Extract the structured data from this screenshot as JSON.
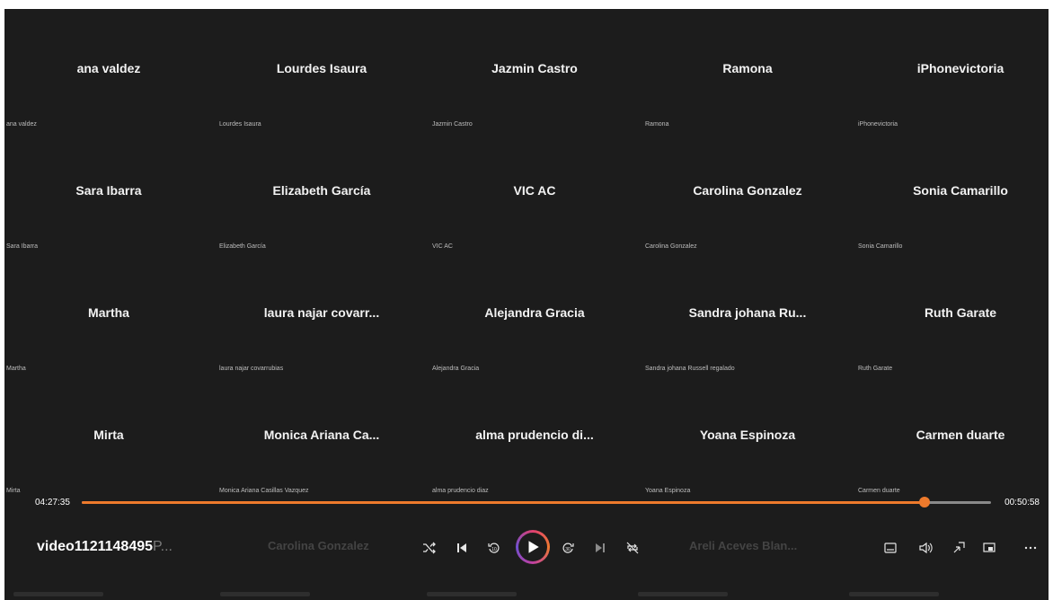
{
  "tiles": [
    {
      "big": "ana valdez",
      "small": "ana valdez"
    },
    {
      "big": "Lourdes Isaura",
      "small": "Lourdes Isaura"
    },
    {
      "big": "Jazmin Castro",
      "small": "Jazmin Castro"
    },
    {
      "big": "Ramona",
      "small": "Ramona"
    },
    {
      "big": "iPhonevictoria",
      "small": "iPhonevictoria"
    },
    {
      "big": "Sara Ibarra",
      "small": "Sara Ibarra"
    },
    {
      "big": "Elizabeth García",
      "small": "Elizabeth García"
    },
    {
      "big": "VIC AC",
      "small": "VIC AC"
    },
    {
      "big": "Carolina Gonzalez",
      "small": "Carolina Gonzalez"
    },
    {
      "big": "Sonia Camarillo",
      "small": "Sonia Camarillo"
    },
    {
      "big": "Martha",
      "small": "Martha"
    },
    {
      "big": "laura najar covarr...",
      "small": "laura najar covarrubias"
    },
    {
      "big": "Alejandra Gracia",
      "small": "Alejandra Gracia"
    },
    {
      "big": "Sandra johana Ru...",
      "small": "Sandra johana Russell regalado"
    },
    {
      "big": "Ruth Garate",
      "small": "Ruth Garate"
    },
    {
      "big": "Mirta",
      "small": "Mirta"
    },
    {
      "big": "Monica Ariana Ca...",
      "small": "Monica Ariana Casillas Vazquez"
    },
    {
      "big": "alma prudencio di...",
      "small": "alma prudencio diaz"
    },
    {
      "big": "Yoana Espinoza",
      "small": "Yoana Espinoza"
    },
    {
      "big": "Carmen duarte",
      "small": "Carmen duarte"
    }
  ],
  "player": {
    "elapsed": "04:27:35",
    "remaining": "00:50:58",
    "progress_fraction": 0.9266,
    "video_title": "video1121148495",
    "video_title_fade": "P...",
    "ghost_left": "Carolina Gonzalez",
    "ghost_right": "Areli Aceves Blan..."
  },
  "icons": {
    "shuffle": "shuffle-icon",
    "previous": "previous-icon",
    "rewind": "rewind-10-icon",
    "play": "play-icon",
    "forward": "forward-30-icon",
    "next": "next-icon",
    "repeat": "repeat-icon",
    "captions": "captions-icon",
    "volume": "volume-icon",
    "miniplayer": "miniplayer-icon",
    "cast": "cast-icon",
    "more": "more-icon"
  },
  "colors": {
    "accent": "#ee7a2c",
    "background": "#1c1c1c"
  }
}
